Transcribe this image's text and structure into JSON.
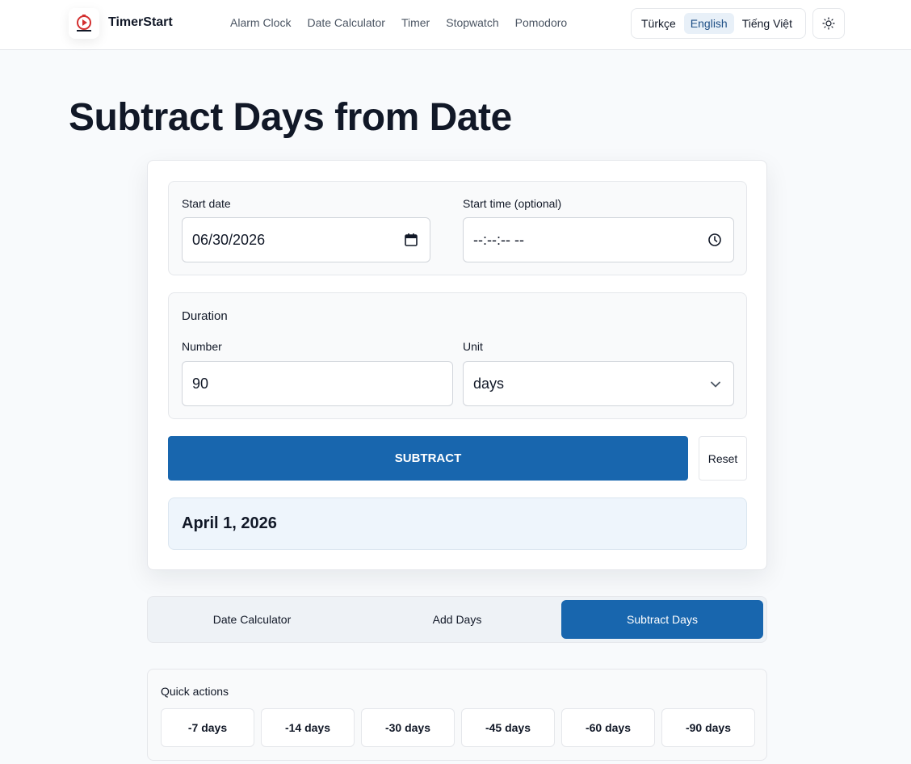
{
  "header": {
    "brand": "TimerStart",
    "nav": [
      "Alarm Clock",
      "Date Calculator",
      "Timer",
      "Stopwatch",
      "Pomodoro"
    ],
    "languages": [
      "Türkçe",
      "English",
      "Tiếng Việt"
    ],
    "active_language": "English",
    "theme_icon": "sun-icon"
  },
  "page": {
    "title": "Subtract Days from Date"
  },
  "form": {
    "start_date_label": "Start date",
    "start_date_value": "06/30/2026",
    "start_time_label": "Start time (optional)",
    "start_time_value": "--:--:-- --",
    "duration_label": "Duration",
    "number_label": "Number",
    "number_value": "90",
    "unit_label": "Unit",
    "unit_value": "days",
    "subtract_label": "SUBTRACT",
    "reset_label": "Reset",
    "result": "April 1, 2026"
  },
  "tabs": {
    "items": [
      "Date Calculator",
      "Add Days",
      "Subtract Days"
    ],
    "active": "Subtract Days"
  },
  "quick_actions": {
    "title": "Quick actions",
    "items": [
      "-7 days",
      "-14 days",
      "-30 days",
      "-45 days",
      "-60 days",
      "-90 days"
    ]
  },
  "colors": {
    "primary": "#1866ae",
    "result_bg": "#eef5fc",
    "brand_red": "#d32f2f"
  }
}
